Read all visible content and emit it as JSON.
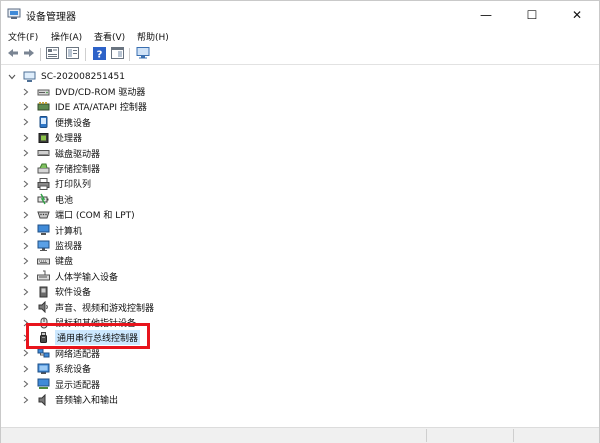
{
  "window": {
    "title": "设备管理器",
    "controls": {
      "minimize": "—",
      "maximize": "☐",
      "close": "✕"
    }
  },
  "menubar": {
    "items": [
      {
        "label": "文件(F)"
      },
      {
        "label": "操作(A)"
      },
      {
        "label": "查看(V)"
      },
      {
        "label": "帮助(H)"
      }
    ]
  },
  "toolbar": {
    "buttons": [
      "back-arrow-icon",
      "forward-arrow-icon",
      "properties-icon",
      "show-hide-tree-icon",
      "help-icon",
      "action-pane-icon",
      "monitor-scan-icon"
    ]
  },
  "tree": {
    "root": {
      "label": "SC-202008251451",
      "expanded": true
    },
    "items": [
      {
        "label": "DVD/CD-ROM 驱动器",
        "icon": "dvd-drive-icon"
      },
      {
        "label": "IDE ATA/ATAPI 控制器",
        "icon": "ide-controller-icon"
      },
      {
        "label": "便携设备",
        "icon": "portable-device-icon"
      },
      {
        "label": "处理器",
        "icon": "processor-icon"
      },
      {
        "label": "磁盘驱动器",
        "icon": "disk-drive-icon"
      },
      {
        "label": "存储控制器",
        "icon": "storage-controller-icon"
      },
      {
        "label": "打印队列",
        "icon": "printer-icon"
      },
      {
        "label": "电池",
        "icon": "battery-icon"
      },
      {
        "label": "端口 (COM 和 LPT)",
        "icon": "port-icon"
      },
      {
        "label": "计算机",
        "icon": "computer-icon"
      },
      {
        "label": "监视器",
        "icon": "monitor-icon"
      },
      {
        "label": "键盘",
        "icon": "keyboard-icon"
      },
      {
        "label": "人体学输入设备",
        "icon": "hid-icon"
      },
      {
        "label": "软件设备",
        "icon": "software-device-icon"
      },
      {
        "label": "声音、视频和游戏控制器",
        "icon": "speaker-icon"
      },
      {
        "label": "鼠标和其他指针设备",
        "icon": "mouse-icon"
      },
      {
        "label": "通用串行总线控制器",
        "icon": "usb-icon",
        "selected": true
      },
      {
        "label": "网络适配器",
        "icon": "network-adapter-icon"
      },
      {
        "label": "系统设备",
        "icon": "system-device-icon"
      },
      {
        "label": "显示适配器",
        "icon": "display-adapter-icon"
      },
      {
        "label": "音频输入和输出",
        "icon": "audio-io-icon"
      }
    ]
  },
  "colors": {
    "highlight_box": "#e8141c",
    "selection": "#cce8ff"
  }
}
